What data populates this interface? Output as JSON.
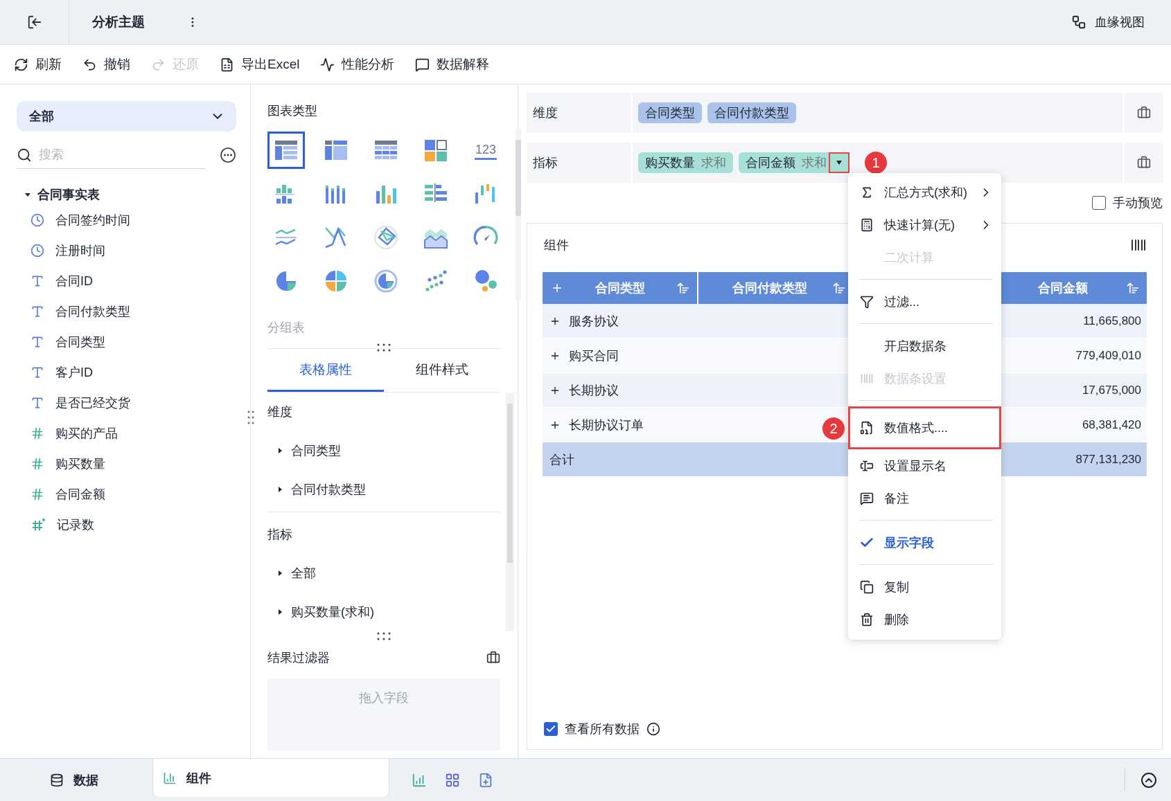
{
  "header": {
    "title": "分析主题",
    "lineage": "血缘视图"
  },
  "toolbar": [
    {
      "label": "刷新",
      "disabled": false
    },
    {
      "label": "撤销",
      "disabled": false
    },
    {
      "label": "还原",
      "disabled": true
    },
    {
      "label": "导出Excel",
      "disabled": false
    },
    {
      "label": "性能分析",
      "disabled": false
    },
    {
      "label": "数据解释",
      "disabled": false
    }
  ],
  "fields_panel": {
    "scope": "全部",
    "search": {
      "placeholder": "搜索"
    },
    "tree": [
      {
        "label": "合同事实表",
        "expanded": true,
        "children": [
          {
            "label": "合同签约时间",
            "kind": "time"
          },
          {
            "label": "注册时间",
            "kind": "time"
          },
          {
            "label": "合同ID",
            "kind": "text"
          },
          {
            "label": "合同付款类型",
            "kind": "text"
          },
          {
            "label": "合同类型",
            "kind": "text"
          },
          {
            "label": "客户ID",
            "kind": "text"
          },
          {
            "label": "是否已经交货",
            "kind": "text"
          },
          {
            "label": "购买的产品",
            "kind": "number"
          },
          {
            "label": "购买数量",
            "kind": "number"
          },
          {
            "label": "合同金额",
            "kind": "number"
          },
          {
            "label": "记录数",
            "kind": "count"
          }
        ]
      }
    ]
  },
  "chart_panel": {
    "title": "图表类型",
    "chart_types": [
      {
        "kind": "group-table",
        "selected": true
      },
      {
        "kind": "cross-table",
        "selected": false
      },
      {
        "kind": "detail-table",
        "selected": false
      },
      {
        "kind": "tiles",
        "selected": false
      },
      {
        "kind": "number",
        "label": "123",
        "selected": false
      },
      {
        "kind": "stacked-bars",
        "selected": false
      },
      {
        "kind": "grouped-bars",
        "selected": false
      },
      {
        "kind": "bars",
        "selected": false
      },
      {
        "kind": "horizontal-bars",
        "selected": false
      },
      {
        "kind": "range-bars",
        "selected": false
      },
      {
        "kind": "lines",
        "selected": false
      },
      {
        "kind": "cross-lines",
        "selected": false
      },
      {
        "kind": "radar",
        "selected": false
      },
      {
        "kind": "area",
        "selected": false
      },
      {
        "kind": "gauge",
        "selected": false
      },
      {
        "kind": "pie",
        "selected": false
      },
      {
        "kind": "quad-pie",
        "selected": false
      },
      {
        "kind": "ring",
        "selected": false
      },
      {
        "kind": "scatter",
        "selected": false
      },
      {
        "kind": "bubble",
        "selected": false
      }
    ],
    "current_type": "分组表",
    "tabs": [
      {
        "label": "表格属性",
        "selected": true
      },
      {
        "label": "组件样式",
        "selected": false
      }
    ],
    "properties": [
      {
        "label": "维度",
        "children": [
          {
            "label": "合同类型",
            "expanded": false
          },
          {
            "label": "合同付款类型",
            "expanded": false
          }
        ]
      },
      {
        "label": "指标",
        "children": [
          {
            "label": "全部",
            "expanded": false
          },
          {
            "label": "购买数量(求和)",
            "expanded": false
          }
        ]
      }
    ],
    "result_filter": {
      "title": "结果过滤器",
      "placeholder": "拖入字段"
    }
  },
  "editor": {
    "dimensions": {
      "label": "维度",
      "fields": [
        {
          "name": "合同类型"
        },
        {
          "name": "合同付款类型"
        }
      ]
    },
    "measures": {
      "label": "指标",
      "fields": [
        {
          "name": "购买数量",
          "aggregation": "求和",
          "menu_open": false
        },
        {
          "name": "合同金额",
          "aggregation": "求和",
          "menu_open": true
        }
      ]
    },
    "manual_preview": {
      "label": "手动预览",
      "checked": false
    },
    "component": {
      "title": "组件",
      "table": {
        "columns": [
          {
            "label": "合同类型"
          },
          {
            "label": "合同付款类型"
          },
          {
            "label": "合同金额"
          }
        ],
        "rows": [
          {
            "label": "服务协议",
            "amount": "11,665,800"
          },
          {
            "label": "购买合同",
            "amount": "779,409,010"
          },
          {
            "label": "长期协议",
            "amount": "17,675,000"
          },
          {
            "label": "长期协议订单",
            "amount": "68,381,420"
          }
        ],
        "total": {
          "label": "合计",
          "amount": "877,131,230"
        }
      },
      "view_all": {
        "label": "查看所有数据",
        "checked": true
      }
    }
  },
  "menu": {
    "sections": [
      [
        {
          "label": "汇总方式(求和)",
          "kind": "submenu",
          "disabled": false,
          "checked": false,
          "highlighted": false
        },
        {
          "label": "快速计算(无)",
          "kind": "submenu",
          "disabled": false,
          "checked": false,
          "highlighted": false
        },
        {
          "label": "二次计算",
          "kind": "action",
          "disabled": true,
          "checked": false,
          "highlighted": false
        }
      ],
      [
        {
          "label": "过滤...",
          "kind": "action",
          "disabled": false,
          "checked": false,
          "highlighted": false
        }
      ],
      [
        {
          "label": "开启数据条",
          "kind": "action",
          "disabled": false,
          "checked": false,
          "highlighted": false
        },
        {
          "label": "数据条设置",
          "kind": "action",
          "disabled": true,
          "checked": false,
          "highlighted": false
        }
      ],
      [
        {
          "label": "数值格式....",
          "kind": "action",
          "disabled": false,
          "checked": false,
          "highlighted": true,
          "badge": "2"
        },
        {
          "label": "设置显示名",
          "kind": "action",
          "disabled": false,
          "checked": false,
          "highlighted": false
        },
        {
          "label": "备注",
          "kind": "action",
          "disabled": false,
          "checked": false,
          "highlighted": false
        }
      ],
      [
        {
          "label": "显示字段",
          "kind": "action",
          "disabled": false,
          "checked": true,
          "highlighted": false
        }
      ],
      [
        {
          "label": "复制",
          "kind": "action",
          "disabled": false,
          "checked": false,
          "highlighted": false
        },
        {
          "label": "删除",
          "kind": "action",
          "disabled": false,
          "checked": false,
          "highlighted": false
        }
      ]
    ],
    "trigger_badge": "1"
  },
  "bottom_bar": {
    "tabs": [
      {
        "label": "数据",
        "selected": false
      },
      {
        "label": "组件",
        "selected": true
      }
    ]
  }
}
